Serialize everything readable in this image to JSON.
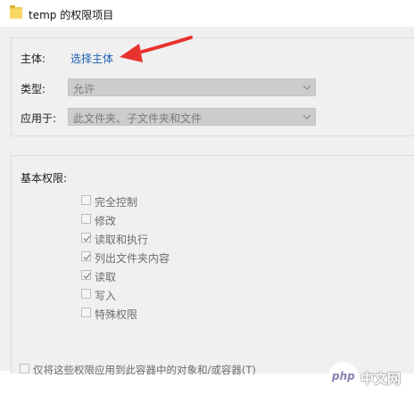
{
  "window": {
    "title": "temp 的权限项目",
    "icon": "folder-icon"
  },
  "principal": {
    "label": "主体:",
    "link_text": "选择主体"
  },
  "type": {
    "label": "类型:",
    "value": "允许"
  },
  "applies_to": {
    "label": "应用于:",
    "value": "此文件夹、子文件夹和文件"
  },
  "basic_permissions": {
    "heading": "基本权限:",
    "items": [
      {
        "label": "完全控制",
        "checked": false
      },
      {
        "label": "修改",
        "checked": false
      },
      {
        "label": "读取和执行",
        "checked": true
      },
      {
        "label": "列出文件夹内容",
        "checked": true
      },
      {
        "label": "读取",
        "checked": true
      },
      {
        "label": "写入",
        "checked": false
      },
      {
        "label": "特殊权限",
        "checked": false
      }
    ]
  },
  "apply_only": {
    "label": "仅将这些权限应用到此容器中的对象和/或容器(T)",
    "checked": false
  },
  "watermark": {
    "logo_text": "php",
    "site_text": "中文网"
  },
  "colors": {
    "link": "#1a5fb4",
    "arrow": "#e8322e",
    "disabled_select": "#cccccc",
    "dialog_bg": "#f0f0f0"
  }
}
